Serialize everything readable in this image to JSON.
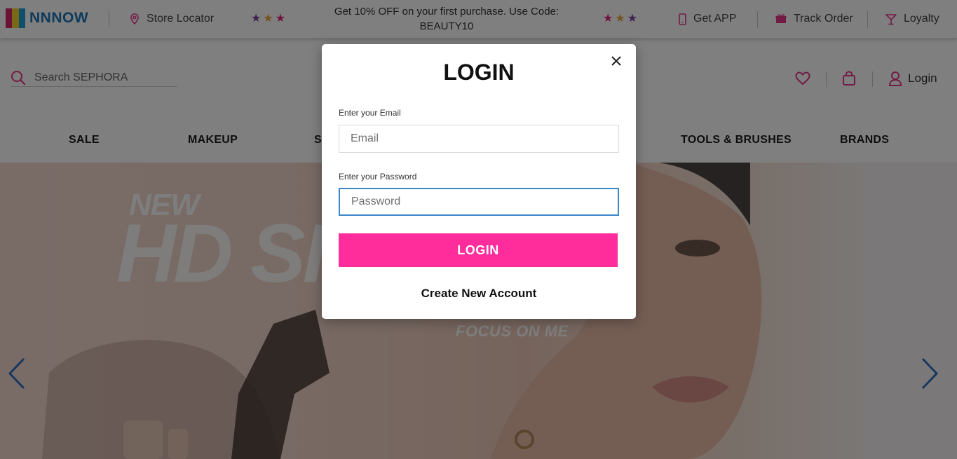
{
  "brand": {
    "name": "NNNOW",
    "accent": "#1f76b7"
  },
  "topbar": {
    "store_locator": "Store Locator",
    "promo_line1": "Get 10% OFF on your first purchase. Use Code:",
    "promo_line2": "BEAUTY10",
    "get_app": "Get APP",
    "track_order": "Track Order",
    "loyalty": "Loyalty",
    "icon_color": "#e4368a",
    "stars_left": [
      "#7b3fa0",
      "#e8a33a",
      "#e0247a"
    ],
    "stars_right": [
      "#e0247a",
      "#e8a33a",
      "#7b3fa0"
    ]
  },
  "header": {
    "search_placeholder": "Search SEPHORA",
    "login_label": "Login",
    "icon_color": "#e4368a"
  },
  "nav": {
    "items": [
      "SALE",
      "MAKEUP",
      "S",
      "TOOLS & BRUSHES",
      "BRANDS"
    ]
  },
  "hero": {
    "title_small": "NEW",
    "title_big": "HD SI",
    "subtitle": "FOCUS ON ME",
    "arrow_color": "#2d6fc3"
  },
  "modal": {
    "title": "LOGIN",
    "email_label": "Enter your Email",
    "email_placeholder": "Email",
    "password_label": "Enter your Password",
    "password_placeholder": "Password",
    "login_button": "LOGIN",
    "create_account": "Create New Account",
    "button_color": "#ff2c9c"
  }
}
